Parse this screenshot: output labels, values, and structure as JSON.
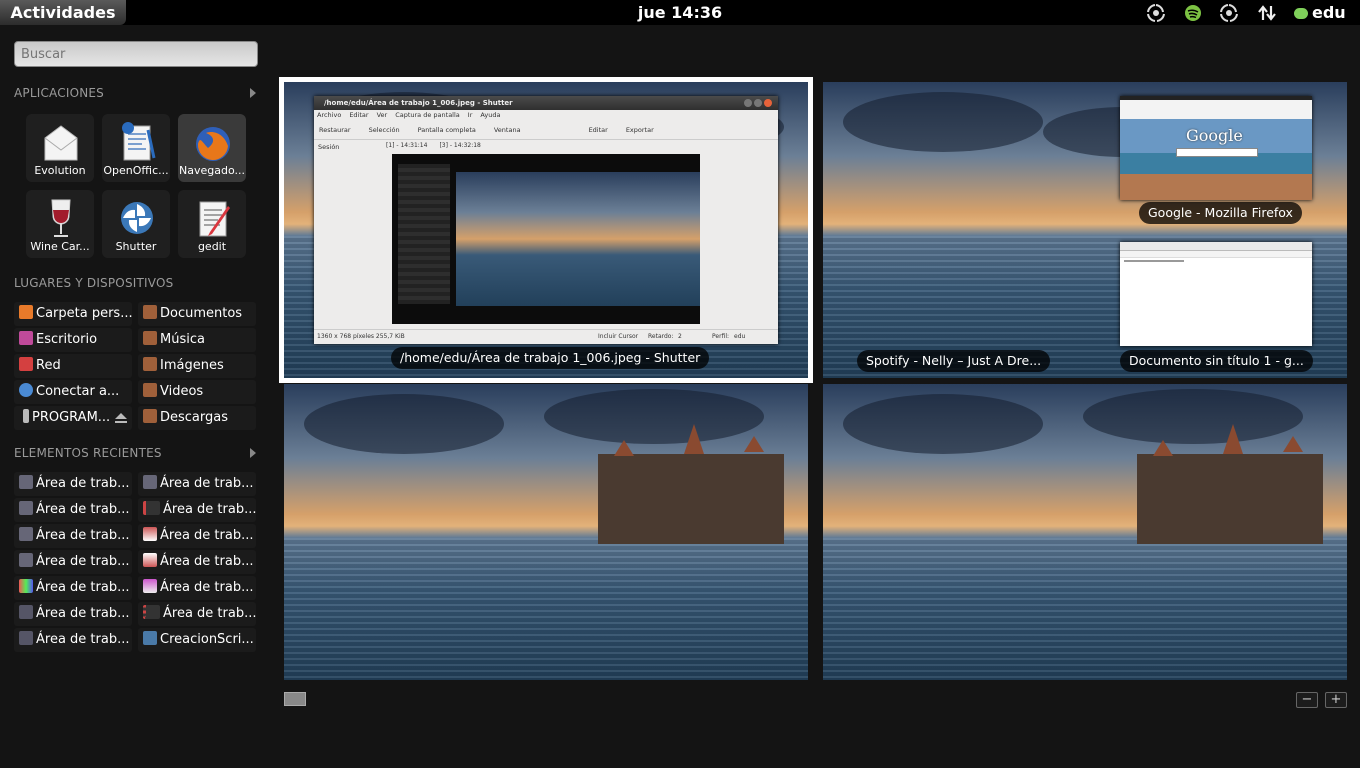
{
  "topbar": {
    "activities": "Actividades",
    "clock": "jue 14:36",
    "user": "edu",
    "tray_icons": [
      "shutter-icon",
      "spotify-icon",
      "shutter-icon",
      "network-icon",
      "chat-icon"
    ]
  },
  "search": {
    "placeholder": "Buscar"
  },
  "applications": {
    "title": "APLICACIONES",
    "items": [
      {
        "label": "Evolution",
        "icon": "evolution-icon"
      },
      {
        "label": "OpenOffic...",
        "icon": "openoffice-icon"
      },
      {
        "label": "Navegado...",
        "icon": "firefox-icon"
      },
      {
        "label": "Wine Car...",
        "icon": "wine-icon"
      },
      {
        "label": "Shutter",
        "icon": "shutter-icon"
      },
      {
        "label": "gedit",
        "icon": "gedit-icon"
      }
    ]
  },
  "places": {
    "title": "LUGARES Y DISPOSITIVOS",
    "left": [
      "Carpeta pers...",
      "Escritorio",
      "Red",
      "Conectar a...",
      "PROGRAM..."
    ],
    "right": [
      "Documentos",
      "Música",
      "Imágenes",
      "Videos",
      "Descargas"
    ]
  },
  "recent": {
    "title": "ELEMENTOS RECIENTES",
    "left": [
      "Área de trab...",
      "Área de trab...",
      "Área de trab...",
      "Área de trab...",
      "Área de trab...",
      "Área de trab...",
      "Área de trab..."
    ],
    "right": [
      "Área de trab...",
      "Área de trab...",
      "Área de trab...",
      "Área de trab...",
      "Área de trab...",
      "Área de trab...",
      "CreacionScri..."
    ]
  },
  "workspaces": {
    "ws1_window": "/home/edu/Área de trabajo 1_006.jpeg - Shutter",
    "ws2_windows": [
      "Google - Mozilla Firefox",
      "Spotify - Nelly – Just A Dre...",
      "Documento sin título 1 - g..."
    ],
    "shutter_thumb": {
      "title": "/home/edu/Área de trabajo 1_006.jpeg - Shutter",
      "menu": [
        "Archivo",
        "Editar",
        "Ver",
        "Captura de pantalla",
        "Ir",
        "Ayuda"
      ],
      "toolbar": [
        "Restaurar",
        "Selección",
        "Pantalla completa",
        "Ventana",
        "Editar",
        "Exportar"
      ],
      "session": "Sesión",
      "tabs": [
        "[1] - 14:31:14",
        "[3] - 14:32:18"
      ],
      "status": "1360 x 768 píxeles  255,7 KiB",
      "cursor": "Incluir Cursor",
      "delay": "Retardo:",
      "delay_value": "2",
      "profile": "Perfil:",
      "profile_value": "edu"
    },
    "google_text": "Google"
  },
  "zoom": {
    "minus": "−",
    "plus": "+"
  },
  "colors": {
    "selection": "#ffffff",
    "accent": "#7fd05a"
  }
}
